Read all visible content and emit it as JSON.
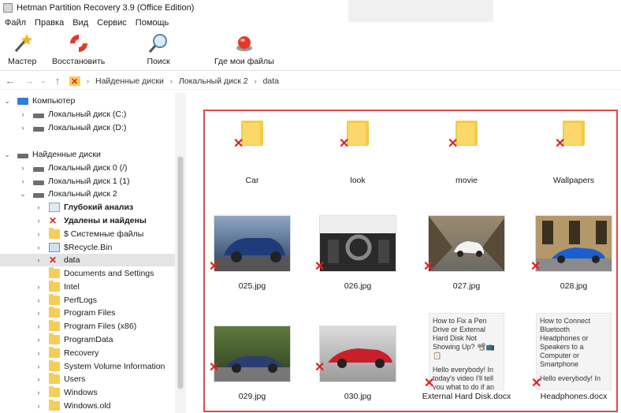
{
  "window": {
    "title": "Hetman Partition Recovery 3.9 (Office Edition)"
  },
  "menu": [
    "Файл",
    "Правка",
    "Вид",
    "Сервис",
    "Помощь"
  ],
  "toolbar": {
    "wizard": "Мастер",
    "restore": "Восстановить",
    "search": "Поиск",
    "where": "Где мои файлы"
  },
  "address": {
    "crumbs": [
      "Найденные диски",
      "Локальный диск 2",
      "data"
    ]
  },
  "tree": {
    "computer": "Компьютер",
    "c": "Локальный диск (C:)",
    "d": "Локальный диск (D:)",
    "found": "Найденные диски",
    "disk0": "Локальный диск 0 (/)",
    "disk1": "Локальный диск 1 (1)",
    "disk2": "Локальный диск 2",
    "deep": "Глубокий анализ",
    "deleted": "Удалены и найдены",
    "system": "$ Системные файлы",
    "recycle": "$Recycle.Bin",
    "data": "data",
    "docs": "Documents and Settings",
    "intel": "Intel",
    "perflogs": "PerfLogs",
    "pf": "Program Files",
    "pf86": "Program Files (x86)",
    "pdata": "ProgramData",
    "recovery": "Recovery",
    "svi": "System Volume Information",
    "users": "Users",
    "windows": "Windows",
    "winold": "Windows.old"
  },
  "files": {
    "car": "Car",
    "look": "look",
    "movie": "movie",
    "wallpapers": "Wallpapers",
    "f025": "025.jpg",
    "f026": "026.jpg",
    "f027": "027.jpg",
    "f028": "028.jpg",
    "f029": "029.jpg",
    "f030": "030.jpg",
    "ext": "External Hard Disk.docx",
    "head": "Headphones.docx",
    "ext_preview_1": "How to Fix a Pen Drive or External Hard Disk Not Showing Up? 📽📺📋",
    "ext_preview_2": "Hello everybody! In today's video I'll tell you what to do if an",
    "head_preview_1": "How to Connect Bluetooth Headphones or Speakers to a Computer or Smartphone",
    "head_preview_2": "Hello everybody! In"
  },
  "colors": {
    "accent": "#e04848",
    "folder": "#f5cd5a",
    "deleted_mark": "#e02020"
  }
}
